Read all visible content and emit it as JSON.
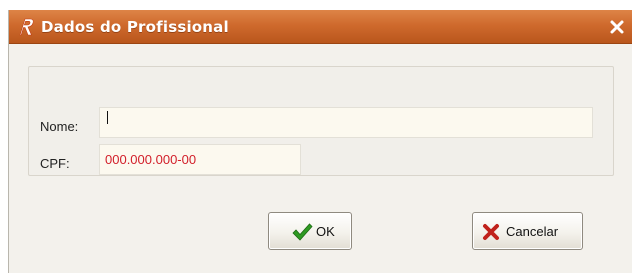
{
  "window": {
    "title": "Dados do Profissional",
    "close_label": "×"
  },
  "form": {
    "nome": {
      "label": "Nome:",
      "value": ""
    },
    "cpf": {
      "label": "CPF:",
      "value": "000.000.000-00"
    }
  },
  "actions": {
    "ok_label": "OK",
    "cancel_label": "Cancelar"
  },
  "icons": {
    "app": "app-logo-icon",
    "close": "close-icon",
    "ok": "checkmark-icon",
    "cancel": "x-icon"
  },
  "colors": {
    "titlebar": "#cf6a2d",
    "cpf_text": "#d21f2a",
    "ok_icon": "#2e9a22",
    "cancel_icon": "#c0221c",
    "field_bg": "#fcf9ef"
  }
}
